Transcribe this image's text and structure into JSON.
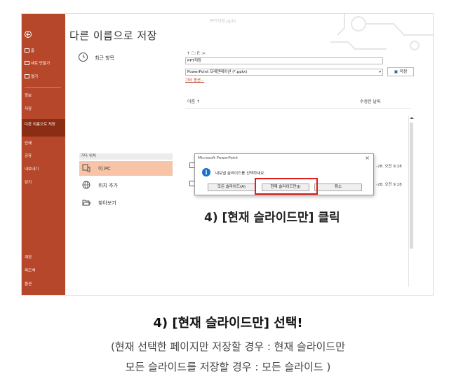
{
  "backstage": {
    "window_title_faint": "PPT저장.pptx",
    "page_title": "다른 이름으로 저장",
    "sidebar": {
      "items": [
        {
          "label": "홈"
        },
        {
          "label": "새로 만들기"
        },
        {
          "label": "열기"
        },
        {
          "label": "정보"
        },
        {
          "label": "저장"
        },
        {
          "label": "다른 이름으로 저장"
        },
        {
          "label": "인쇄"
        },
        {
          "label": "공유"
        },
        {
          "label": "내보내기"
        },
        {
          "label": "닫기"
        },
        {
          "label": "계정"
        },
        {
          "label": "피드백"
        },
        {
          "label": "옵션"
        }
      ],
      "selected": "다른 이름으로 저장"
    },
    "recent_label": "최근 항목",
    "other_locations_header": "기타 위치",
    "locations": [
      {
        "label": "이 PC"
      },
      {
        "label": "위치 추가"
      },
      {
        "label": "찾아보기"
      }
    ],
    "path": "↑  🗀 F: >",
    "filename_value": "PPT저장",
    "filetype_value": "PowerPoint 프레젠테이션 (*.pptx)",
    "more_options": "기타 옵션...",
    "save_button": "저장",
    "col_name": "이름 ↑",
    "col_modified": "수정한 날짜",
    "row_dates": [
      "-28. 오전 9:28",
      "-28. 오전 9:28"
    ]
  },
  "dialog": {
    "title": "Microsoft PowerPoint",
    "message": "내보낼 슬라이드를 선택하세요.",
    "buttons": {
      "all": "모든 슬라이드(A)",
      "current": "현재 슬라이드만(J)",
      "cancel": "취소"
    }
  },
  "callout": "4) [현재 슬라이드만] 클릭",
  "caption": {
    "line1": "4) [현재 슬라이드만] 선택!",
    "line2": "(현재 선택한 페이지만 저장할 경우 : 현재 슬라이드만",
    "line3": "모든 슬라이드를 저장할 경우 : 모든 슬라이드 )"
  },
  "colors": {
    "sidebar": "#b7472a",
    "sidebar_selected": "#8b2c14",
    "location_active": "#f7c4a8",
    "highlight": "#e11d1d",
    "info_icon": "#1a6fd1"
  }
}
